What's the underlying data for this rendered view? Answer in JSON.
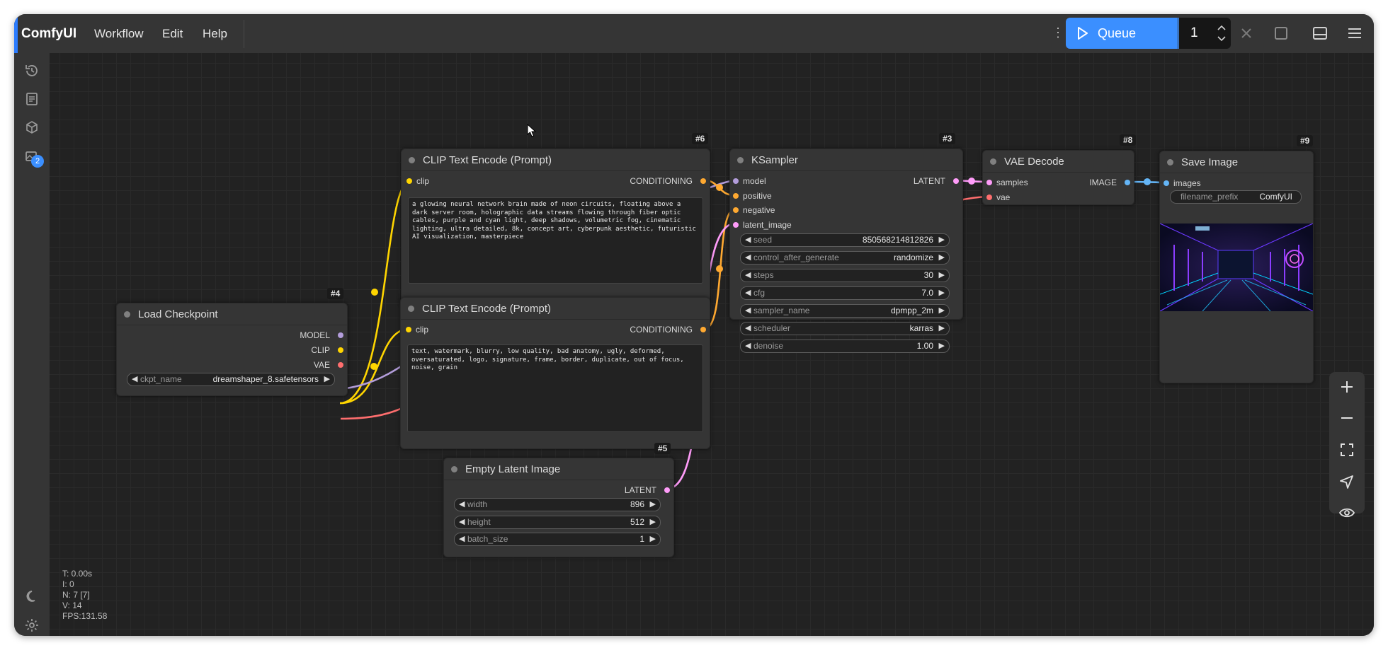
{
  "topbar": {
    "brand": "ComfyUI",
    "menus": [
      "Workflow",
      "Edit",
      "Help"
    ],
    "queue_label": "Queue",
    "queue_count": "1",
    "accent": "#3b8fff"
  },
  "sidebar": {
    "icons": [
      "history-icon",
      "list-icon",
      "cube-icon",
      "images-icon"
    ],
    "badge": "2",
    "bottom_icons": [
      "moon-icon",
      "gear-icon"
    ]
  },
  "stats": [
    "T: 0.00s",
    "I: 0",
    "N: 7 [7]",
    "V: 14",
    "FPS:131.58"
  ],
  "nodes": {
    "clip_pos": {
      "id": "#6",
      "title": "CLIP Text Encode (Prompt)",
      "input": "clip",
      "output": "CONDITIONING",
      "text": "a glowing neural network brain made of neon circuits, floating above a dark server room, holographic data streams flowing through fiber optic cables, purple and cyan light, deep shadows, volumetric fog, cinematic lighting, ultra detailed, 8k, concept art, cyberpunk aesthetic, futuristic AI visualization, masterpiece"
    },
    "clip_neg": {
      "id": "",
      "title": "CLIP Text Encode (Prompt)",
      "input": "clip",
      "output": "CONDITIONING",
      "text": "text, watermark, blurry, low quality, bad anatomy, ugly, deformed, oversaturated, logo, signature, frame, border, duplicate, out of focus, noise, grain"
    },
    "ksampler": {
      "id": "#3",
      "title": "KSampler",
      "inputs": [
        "model",
        "positive",
        "negative",
        "latent_image"
      ],
      "output": "LATENT",
      "widgets": [
        {
          "label": "seed",
          "value": "850568214812826"
        },
        {
          "label": "control_after_generate",
          "value": "randomize"
        },
        {
          "label": "steps",
          "value": "30"
        },
        {
          "label": "cfg",
          "value": "7.0"
        },
        {
          "label": "sampler_name",
          "value": "dpmpp_2m"
        },
        {
          "label": "scheduler",
          "value": "karras"
        },
        {
          "label": "denoise",
          "value": "1.00"
        }
      ]
    },
    "vae_decode": {
      "id": "#8",
      "title": "VAE Decode",
      "inputs": [
        "samples",
        "vae"
      ],
      "output": "IMAGE"
    },
    "save_image": {
      "id": "#9",
      "title": "Save Image",
      "input": "images",
      "widget_label": "filename_prefix",
      "widget_value": "ComfyUI"
    },
    "load_checkpoint": {
      "id": "#4",
      "title": "Load Checkpoint",
      "outputs": [
        "MODEL",
        "CLIP",
        "VAE"
      ],
      "widget_label": "ckpt_name",
      "widget_value": "dreamshaper_8.safetensors"
    },
    "empty_latent": {
      "id": "#5",
      "title": "Empty Latent Image",
      "output": "LATENT",
      "widgets": [
        {
          "label": "width",
          "value": "896"
        },
        {
          "label": "height",
          "value": "512"
        },
        {
          "label": "batch_size",
          "value": "1"
        }
      ]
    }
  },
  "colors": {
    "model": "#b39ddb",
    "clip": "#ffd500",
    "vae": "#ff6e6e",
    "conditioning": "#ffa931",
    "latent": "#ff9cf9",
    "image": "#64b5f6"
  }
}
